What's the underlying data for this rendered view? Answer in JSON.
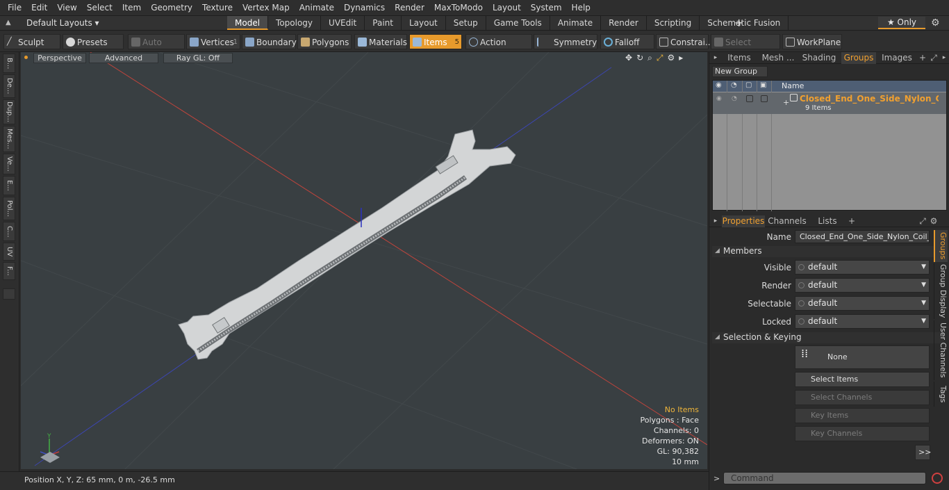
{
  "menu": [
    "File",
    "Edit",
    "View",
    "Select",
    "Item",
    "Geometry",
    "Texture",
    "Vertex Map",
    "Animate",
    "Dynamics",
    "Render",
    "MaxToModo",
    "Layout",
    "System",
    "Help"
  ],
  "layoutbar": {
    "layouts_label": "Default Layouts ▾",
    "tabs": [
      "Model",
      "Topology",
      "UVEdit",
      "Paint",
      "Layout",
      "Setup",
      "Game Tools",
      "Animate",
      "Render",
      "Scripting",
      "Schematic Fusion"
    ],
    "active_tab": "Model",
    "only_label": "★  Only"
  },
  "toolbar": {
    "sculpt": "Sculpt",
    "presets": "Presets",
    "auto_select": "Auto Select",
    "vertices": "Vertices",
    "vertices_count": "1",
    "boundary": "Boundary",
    "polygons": "Polygons",
    "materials": "Materials",
    "items": "Items",
    "items_count": "5",
    "action_center": "Action Center",
    "symmetry": "Symmetry",
    "falloff": "Falloff",
    "constraints": "Constrai...",
    "select_through": "Select Through",
    "workplane": "WorkPlane"
  },
  "left_tools": [
    "B...",
    "De...",
    "Dup...",
    "Mes...",
    "Ve...",
    "E...",
    "Pol...",
    "C...",
    "UV",
    "F..."
  ],
  "viewport": {
    "perspective": "Perspective",
    "advanced": "Advanced",
    "raygl": "Ray GL: Off",
    "info": {
      "no_items": "No Items",
      "polygons": "Polygons : Face",
      "channels": "Channels: 0",
      "deformers": "Deformers: ON",
      "gl": "GL: 90,382",
      "scale": "10 mm"
    },
    "axis_y": "Y"
  },
  "status": {
    "position": "Position X, Y, Z:   65 mm, 0 m, -26.5 mm"
  },
  "right_tabs": [
    "Items",
    "Mesh ...",
    "Shading",
    "Groups",
    "Images"
  ],
  "right_active": "Groups",
  "groups": {
    "new_group": "New Group",
    "col_name": "Name",
    "row_name": "Closed_End_One_Side_Nylon_Co...",
    "row_sub": "9 Items"
  },
  "props_tabs": [
    "Properties",
    "Channels",
    "Lists"
  ],
  "props": {
    "name_label": "Name",
    "name_value": "Closed_End_One_Side_Nylon_Coil_Zip",
    "members": "Members",
    "visible_label": "Visible",
    "render_label": "Render",
    "selectable_label": "Selectable",
    "locked_label": "Locked",
    "default_value": "default",
    "sel_keying": "Selection & Keying",
    "none": "None",
    "select_items": "Select Items",
    "select_channels": "Select Channels",
    "key_items": "Key Items",
    "key_channels": "Key Channels",
    "more": ">>"
  },
  "side_tabs": [
    "Groups",
    "Group Display",
    "User Channels",
    "Tags"
  ],
  "command_placeholder": "Command",
  "colors": {
    "accent": "#e79a2c",
    "viewport_bg": "#393f42"
  }
}
